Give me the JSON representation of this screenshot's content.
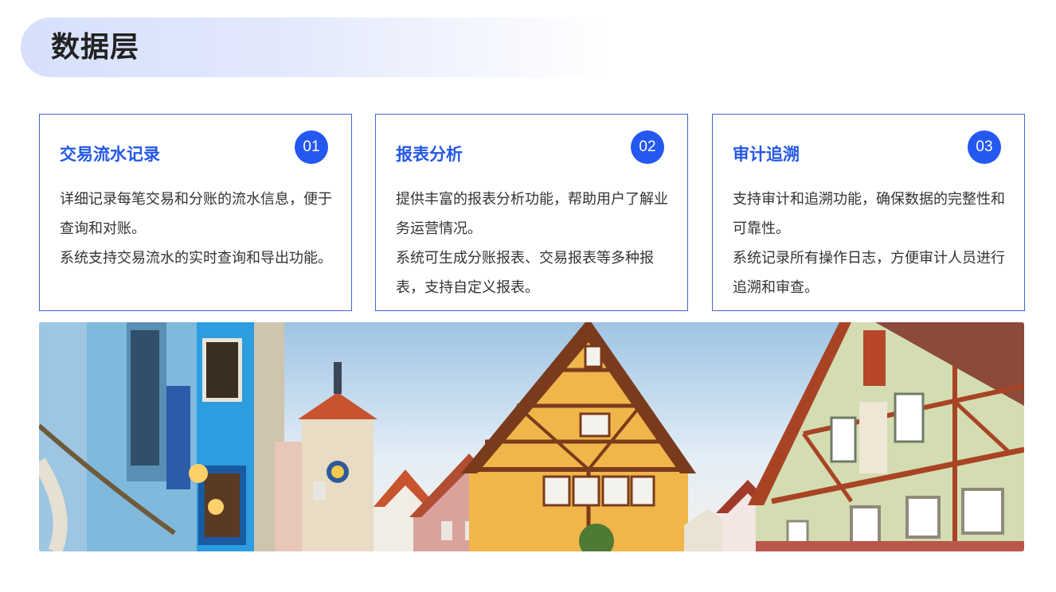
{
  "header": {
    "title": "数据层"
  },
  "cards": [
    {
      "title": "交易流水记录",
      "number": "01",
      "lines": [
        "详细记录每笔交易和分账的流水信息，便于查询和对账。",
        "系统支持交易流水的实时查询和导出功能。"
      ]
    },
    {
      "title": "报表分析",
      "number": "02",
      "lines": [
        "提供丰富的报表分析功能，帮助用户了解业务运营情况。",
        "系统可生成分账报表、交易报表等多种报表，支持自定义报表。"
      ]
    },
    {
      "title": "审计追溯",
      "number": "03",
      "lines": [
        "支持审计和追溯功能，确保数据的完整性和可靠性。",
        "系统记录所有操作日志，方便审计人员进行追溯和审查。"
      ]
    }
  ],
  "colors": {
    "accent": "#2458e6",
    "card_border": "#3f66d6",
    "badge": "#2458f0"
  }
}
